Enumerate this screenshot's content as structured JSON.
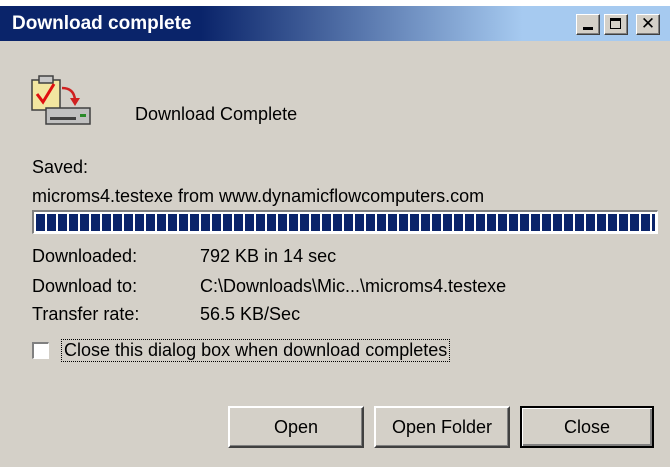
{
  "window": {
    "title": "Download complete"
  },
  "dialog": {
    "heading": "Download Complete",
    "saved_label": "Saved:",
    "saved_detail": "microms4.testexe from www.dynamicflowcomputers.com",
    "progress": 1.0
  },
  "info": {
    "rows": [
      {
        "label": "Downloaded:",
        "value": "792 KB in 14 sec"
      },
      {
        "label": "Download to:",
        "value": "C:\\Downloads\\Mic...\\microms4.testexe"
      },
      {
        "label": "Transfer rate:",
        "value": "56.5 KB/Sec"
      }
    ]
  },
  "options": {
    "close_when_done_label": "Close this dialog box when download completes",
    "close_when_done_checked": false
  },
  "buttons": {
    "open": "Open",
    "open_folder": "Open Folder",
    "close": "Close"
  },
  "colors": {
    "title_start": "#0a246a",
    "title_end": "#a6caf0",
    "face": "#d4d0c8",
    "progress": "#0a246a"
  },
  "icons": {
    "app": "download-complete-icon",
    "minimize": "minimize-icon",
    "maximize": "maximize-icon",
    "close": "close-icon"
  }
}
